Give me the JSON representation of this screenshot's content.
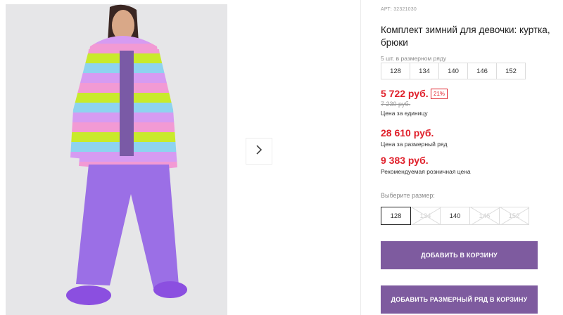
{
  "product": {
    "article": "АРТ: 32321030",
    "title": "Комплект зимний для девочки: куртка, брюки"
  },
  "pack": {
    "label": "5 шт. в размерном ряду",
    "sizes": [
      "128",
      "134",
      "140",
      "146",
      "152"
    ]
  },
  "prices": {
    "main": "5 722 руб.",
    "discount": "21%",
    "old": "7 230 руб.",
    "unit_label": "Цена за единицу",
    "row_price": "28 610 руб.",
    "row_label": "Цена за размерный ряд",
    "rrp": "9 383 руб.",
    "rrp_label": "Рекомендуемая розничная цена"
  },
  "size_select": {
    "label": "Выберите размер:",
    "options": [
      {
        "label": "128",
        "state": "selected"
      },
      {
        "label": "134",
        "state": "disabled"
      },
      {
        "label": "140",
        "state": "available"
      },
      {
        "label": "146",
        "state": "disabled"
      },
      {
        "label": "152",
        "state": "disabled"
      }
    ]
  },
  "buttons": {
    "add_to_cart": "ДОБАВИТЬ В КОРЗИНУ",
    "add_row_to_cart": "ДОБАВИТЬ РАЗМЕРНЫЙ РЯД В КОРЗИНУ"
  },
  "gallery": {
    "next_icon": "chevron-right-icon"
  },
  "colors": {
    "accent": "#7e5b9f",
    "price": "#e0202b"
  }
}
